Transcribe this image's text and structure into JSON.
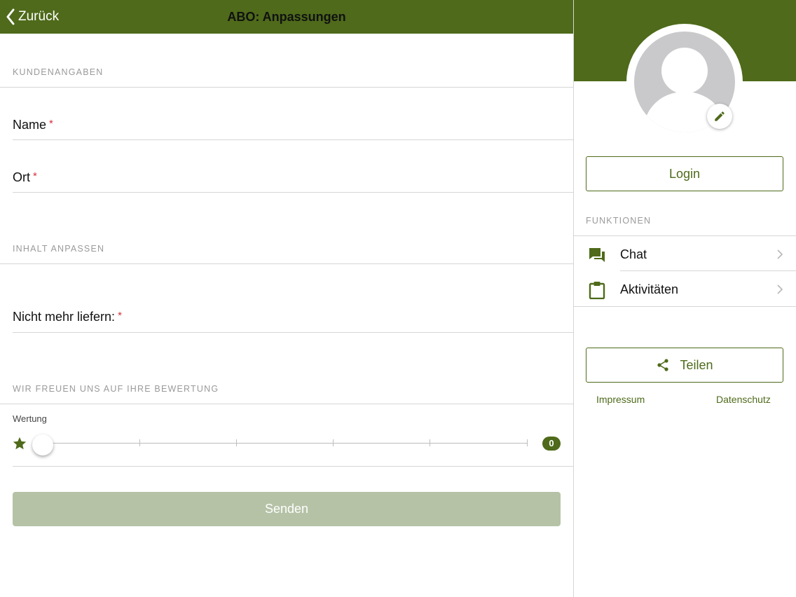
{
  "header": {
    "back_label": "Zurück",
    "title": "ABO: Anpassungen"
  },
  "form": {
    "section_customer": "KUNDENANGABEN",
    "name_label": "Name",
    "location_label": "Ort",
    "required_mark": "*",
    "section_content": "INHALT ANPASSEN",
    "stop_delivery_label": "Nicht mehr liefern:",
    "section_rating": "WIR FREUEN UNS AUF IHRE BEWERTUNG",
    "rating_label": "Wertung",
    "rating_value": "0",
    "rating_min": 0,
    "rating_max": 5,
    "submit_label": "Senden"
  },
  "sidebar": {
    "login_label": "Login",
    "functions_header": "FUNKTIONEN",
    "items": [
      {
        "label": "Chat",
        "icon": "chat-icon"
      },
      {
        "label": "Aktivitäten",
        "icon": "clipboard-icon"
      }
    ],
    "share_label": "Teilen",
    "imprint_label": "Impressum",
    "privacy_label": "Datenschutz"
  },
  "colors": {
    "brand": "#4e6a1a",
    "button_disabled": "#b5c2a6",
    "required": "#d6313b",
    "avatar_bg": "#c9c9cb"
  }
}
